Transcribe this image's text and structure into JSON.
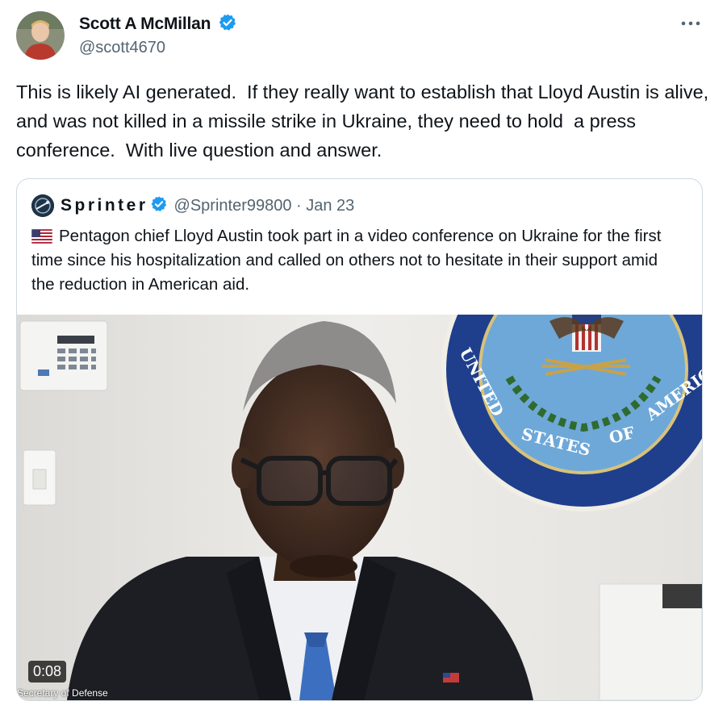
{
  "author": {
    "name": "Scott A McMillan",
    "handle": "@scott4670",
    "verified": true
  },
  "more_icon": "more-dots-icon",
  "tweet": {
    "text": "This is likely AI generated.  If they really want to establish that Lloyd Austin is alive, and was not killed in a missile strike in Ukraine, they need to hold  a press conference.  With live question and answer."
  },
  "quote": {
    "name": "Sprinter",
    "handle": "@Sprinter99800 · Jan 23",
    "flag": "us-flag-icon",
    "text": "Pentagon chief Lloyd Austin took part in a video conference on Ukraine for the first time since his hospitalization and called on others not to hesitate in their support amid the reduction in American aid.",
    "video": {
      "duration": "0:08",
      "caption": "Secretary of Defense",
      "seal_text": "UNITED STATES OF AMERICA"
    }
  },
  "colors": {
    "verified_blue": "#1d9bf0",
    "text": "#0f1419",
    "muted": "#536471",
    "border": "#cfd9de"
  }
}
